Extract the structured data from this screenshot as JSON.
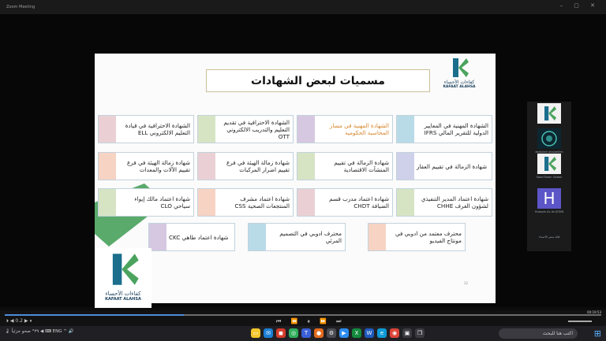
{
  "window": {
    "title": "Zoom Meeting",
    "center_title": "",
    "window_controls": "– ▢ ✕"
  },
  "slide": {
    "title": "مسميات لبعض الشهادات",
    "logo": {
      "ar": "كفاءات الأحساء",
      "en": "KAFAAT ALAHSA"
    },
    "page_number": "12",
    "cards": [
      {
        "text": "الشهادة المهنية في المعايير الدولية للتقرير المالي IFRS",
        "color": "#b9dbe8",
        "orange": false
      },
      {
        "text": "الشهادة المهنية في مسار المحاسبة الحكومية",
        "color": "#d6c8e0",
        "orange": true
      },
      {
        "text": "الشهادة الاحترافية في تقديم التعليم والتدريب الالكتروني OTT",
        "color": "#d6e4c4",
        "orange": false
      },
      {
        "text": "الشهادة الاحترافية في قيادة التعليم الالكتروني ELL",
        "color": "#ead0d4",
        "orange": false
      },
      {
        "text": "شهادة الزمالة في تقييم العقار",
        "color": "#cfd0e9",
        "orange": false
      },
      {
        "text": "شهادة الزمالة في تقييم المنشآت الاقتصادية",
        "color": "#d6e4c4",
        "orange": false
      },
      {
        "text": "شهادة زمالة الهيئة في فرع تقييم اضرار المركبات",
        "color": "#ead0d4",
        "orange": false
      },
      {
        "text": "شهادة زمالة الهيئة في فرع تقييم الآلات والمعدات",
        "color": "#f7d3c4",
        "orange": false
      },
      {
        "text": "شهادة اعتماد المدير التنفيذي لشؤون الغرف CHHE",
        "color": "#d6e4c4",
        "orange": false
      },
      {
        "text": "شهادة اعتماد مدرب قسم الضيافة CHDT",
        "color": "#ead0d4",
        "orange": false
      },
      {
        "text": "شهادة اعتماد مشرف المنتجعات الصحية CSS",
        "color": "#f7d3c4",
        "orange": false
      },
      {
        "text": "شهادة اعتماد مالك إيواء سياحي CLO",
        "color": "#d6e4c4",
        "orange": false
      },
      {
        "text": "محترف معتمد من ادوبي في مونتاج الفيديو",
        "color": "#f7d3c4",
        "orange": false
      },
      {
        "text": "محترف ادوبي في التصميم المرئي",
        "color": "#b9dbe8",
        "orange": false
      },
      {
        "text": "شهادة اعتماد طاهي CKC",
        "color": "#d6c8e0",
        "orange": false
      }
    ]
  },
  "participants": [
    {
      "name": "",
      "kind": "logo"
    },
    {
      "name": "abdullah alssweilim",
      "kind": "dark"
    },
    {
      "name": "Saad Ewan Gaban",
      "kind": "logo"
    },
    {
      "name": "Hussain AL ALQITAN",
      "letter": "H",
      "kind": "purple"
    },
    {
      "name": "قائد سنتر الأحساء",
      "kind": "none"
    }
  ],
  "player": {
    "left_text": "⏵ ◀ 0.2 ▶ ⏸",
    "center": "⏮ ⏪ ⏸ ⏩ ⏭",
    "right_text": "⛶ 🔊",
    "time": "00:19:53",
    "progress": 0.3
  },
  "taskbar": {
    "left_text": "🌡 ٢٩° صحو جزئياً   ◀ ⌨ ENG  ^  🔊",
    "search_placeholder": "اكتب هنا للبحث",
    "start": "⊞"
  }
}
